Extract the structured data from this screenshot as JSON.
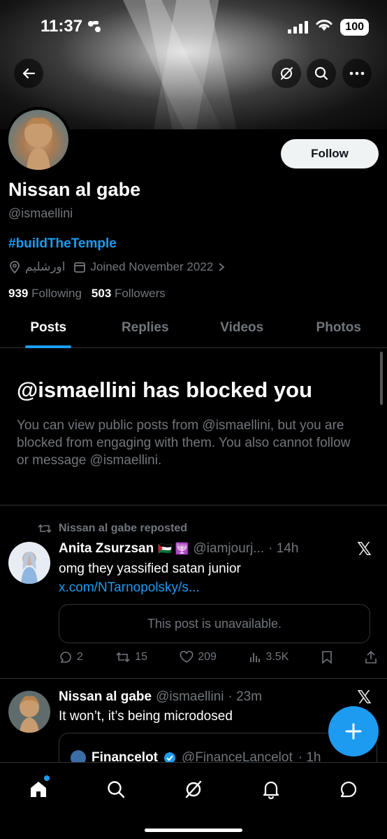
{
  "status": {
    "time": "11:37",
    "battery": "100"
  },
  "profile": {
    "name": "Nissan al gabe",
    "handle": "@ismaellini",
    "bio": "#buildTheTemple",
    "location": "اورشليم",
    "joined": "Joined November 2022",
    "following_count": "939",
    "following_label": "Following",
    "followers_count": "503",
    "followers_label": "Followers",
    "follow_label": "Follow"
  },
  "tabs": [
    {
      "label": "Posts"
    },
    {
      "label": "Replies"
    },
    {
      "label": "Videos"
    },
    {
      "label": "Photos"
    }
  ],
  "blocked": {
    "title": "@ismaellini has blocked you",
    "description": "You can view public posts from @ismaellini, but you are blocked from engaging with them. You also cannot follow or message @ismaellini."
  },
  "posts": [
    {
      "repost_label": "Nissan al gabe reposted",
      "author": "Anita Zsurzsan",
      "flags": "🇵🇸 🕎",
      "handle": "@iamjourj...",
      "time": "· 14h",
      "text": "omg they yassified satan junior ",
      "link": "x.com/NTarnopolsky/s...",
      "unavailable": "This post is unavailable.",
      "replies": "2",
      "reposts": "15",
      "likes": "209",
      "views": "3.5K"
    },
    {
      "author": "Nissan al gabe",
      "handle": "@ismaellini",
      "time": "· 23m",
      "text": "It won’t, it’s being microdosed",
      "quote_author": "Financelot",
      "quote_handle": "@FinanceLancelot",
      "quote_time": "· 1h"
    }
  ]
}
